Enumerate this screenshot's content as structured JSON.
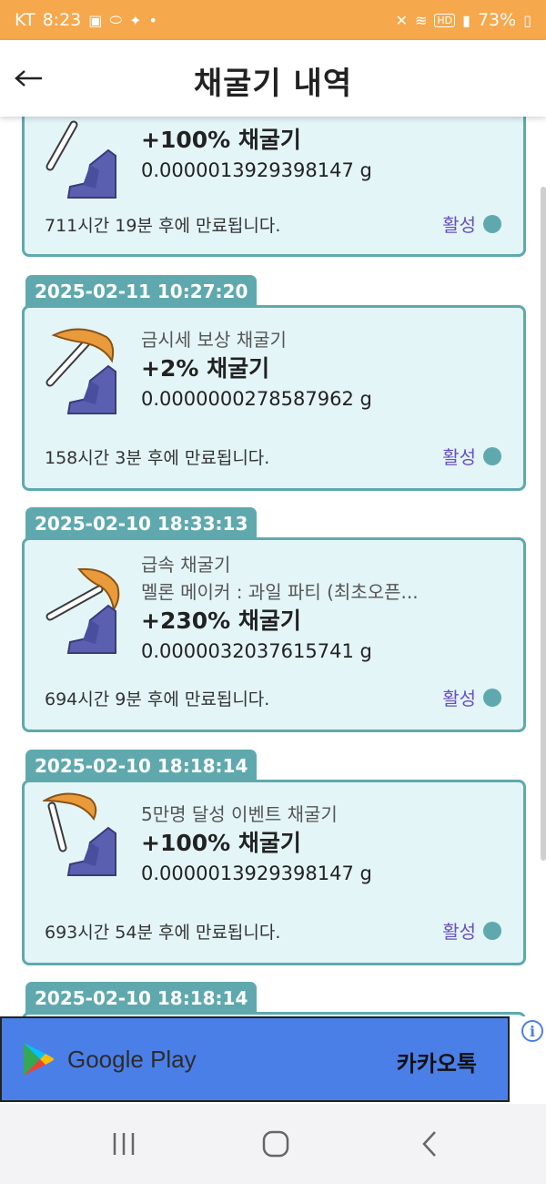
{
  "status_bar": {
    "carrier": "KT",
    "time": "8:23",
    "battery": "73%",
    "hd": "HD"
  },
  "header": {
    "title": "채굴기 내역",
    "back_icon": "arrow-left-icon"
  },
  "cards": [
    {
      "date": "",
      "label": "",
      "label2": "",
      "boost": "+100% 채굴기",
      "amount": "0.0000013929398147 g",
      "expire": "711시간 19분 후에 만료됩니다.",
      "status": "활성"
    },
    {
      "date": "2025-02-11 10:27:20",
      "label": "금시세 보상 채굴기",
      "label2": "",
      "boost": "+2% 채굴기",
      "amount": "0.0000000278587962 g",
      "expire": "158시간 3분 후에 만료됩니다.",
      "status": "활성"
    },
    {
      "date": "2025-02-10 18:33:13",
      "label": "급속 채굴기",
      "label2": "멜론 메이커 : 과일 파티 (최초오픈...",
      "boost": "+230% 채굴기",
      "amount": "0.0000032037615741 g",
      "expire": "694시간 9분 후에 만료됩니다.",
      "status": "활성"
    },
    {
      "date": "2025-02-10 18:18:14",
      "label": "5만명 달성 이벤트 채굴기",
      "label2": "",
      "boost": "+100% 채굴기",
      "amount": "0.0000013929398147 g",
      "expire": "693시간 54분 후에 만료됩니다.",
      "status": "활성"
    },
    {
      "date": "2025-02-10 18:18:14"
    }
  ],
  "ad": {
    "store": "Google Play",
    "app_name": "카카오톡",
    "info_glyph": "i"
  },
  "colors": {
    "status_bar": "#F5A84C",
    "card_bg": "#E3F5F7",
    "card_border": "#5FA9AE",
    "active": "#6A4FC2",
    "ad_bg": "#4B7FE8"
  }
}
